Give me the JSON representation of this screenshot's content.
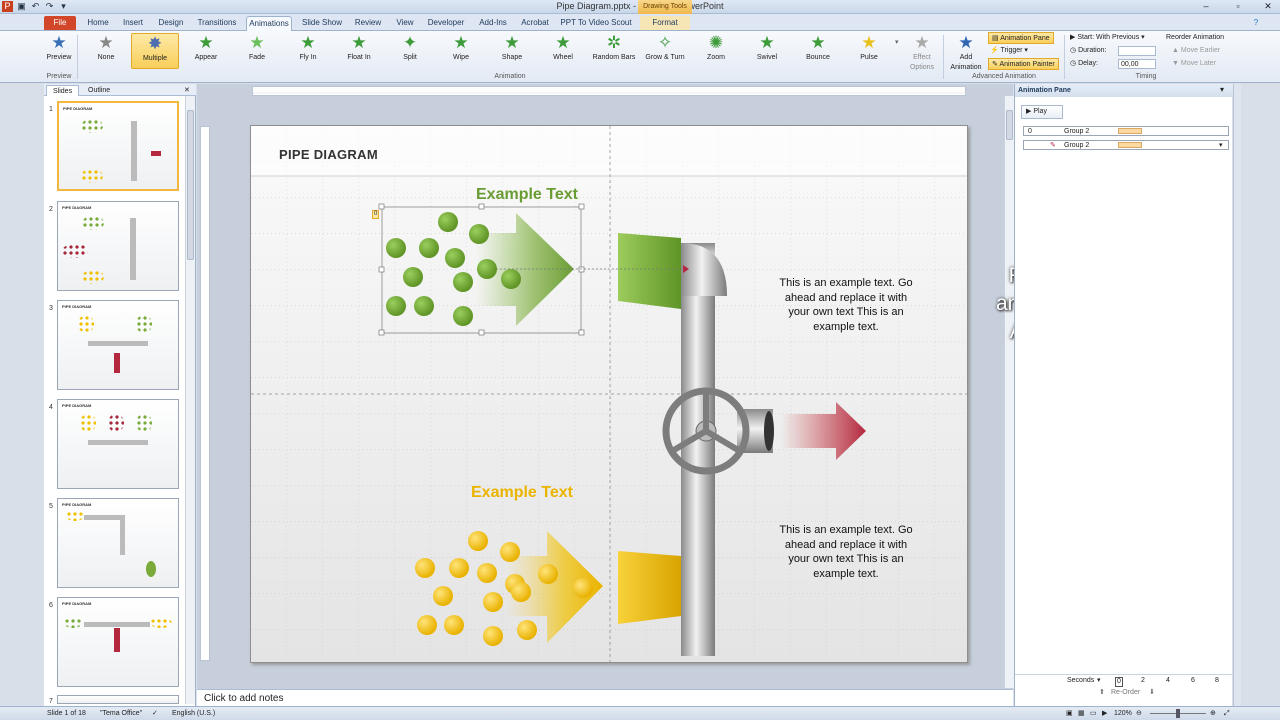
{
  "window": {
    "title": "Pipe Diagram.pptx - Microsoft PowerPoint",
    "context_tab": "Drawing Tools"
  },
  "tabs": [
    "File",
    "Home",
    "Insert",
    "Design",
    "Transitions",
    "Animations",
    "Slide Show",
    "Review",
    "View",
    "Developer",
    "Add-Ins",
    "Acrobat",
    "PPT To Video Scout",
    "Format"
  ],
  "ribbon": {
    "preview": "Preview",
    "preview_group": "Preview",
    "effects": [
      "None",
      "Multiple",
      "Appear",
      "Fade",
      "Fly In",
      "Float In",
      "Split",
      "Wipe",
      "Shape",
      "Wheel",
      "Random Bars",
      "Grow & Turn",
      "Zoom",
      "Swivel",
      "Bounce",
      "Pulse"
    ],
    "effect_options": "Effect Options",
    "animation_group": "Animation",
    "add_animation": "Add Animation",
    "animation_pane": "Animation Pane",
    "trigger": "Trigger",
    "animation_painter": "Animation Painter",
    "advanced_group": "Advanced Animation",
    "start_label": "Start:",
    "start_value": "With Previous",
    "duration_label": "Duration:",
    "duration_value": "",
    "delay_label": "Delay:",
    "delay_value": "00,00",
    "reorder": "Reorder Animation",
    "move_earlier": "Move Earlier",
    "move_later": "Move Later",
    "timing_group": "Timing"
  },
  "left_panel": {
    "tab_slides": "Slides",
    "tab_outline": "Outline",
    "thumb_title": "PIPE DIAGRAM",
    "slide_numbers": [
      "1",
      "2",
      "3",
      "4",
      "5",
      "6",
      "7"
    ]
  },
  "slide": {
    "title": "PIPE DIAGRAM",
    "example_text_top": "Example Text",
    "example_text_bottom": "Example Text",
    "body_top": "This is an example text. Go ahead and replace it with your own text This is an example text.",
    "body_bottom": "This is an example text. Go ahead and replace it with your own text This is an example text.",
    "anim_marker": "0"
  },
  "animation_pane": {
    "title": "Animation Pane",
    "play": "Play",
    "rows": [
      {
        "index": "0",
        "name": "Group 2"
      },
      {
        "index": "",
        "name": "Group 2"
      }
    ],
    "seconds": "Seconds",
    "ticks": [
      "0",
      "2",
      "4",
      "6",
      "8"
    ],
    "reorder": "Re-Order"
  },
  "notes": {
    "placeholder": "Click to add notes"
  },
  "status": {
    "slide": "Slide 1 of 18",
    "theme": "\"Tema Office\"",
    "language": "English (U.S.)",
    "zoom": "120%"
  },
  "overlay": {
    "line1": "For duplication the",
    "line2": "animation effects use",
    "line3": "Animation Painter."
  },
  "colors": {
    "green": "#6a9c34",
    "yellow": "#eab400",
    "red": "#b3283e",
    "file_tab": "#d2472a"
  }
}
